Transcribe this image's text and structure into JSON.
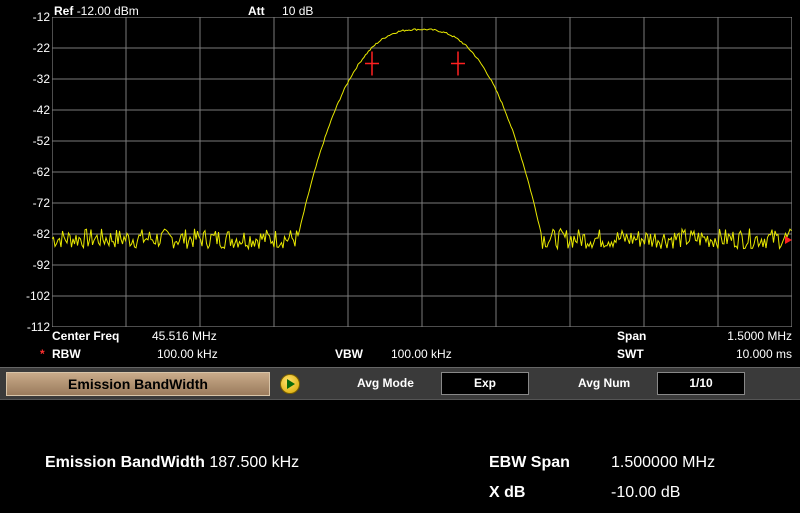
{
  "header": {
    "ref_label": "Ref",
    "ref_value": "-12.00 dBm",
    "att_label": "Att",
    "att_value": "10 dB"
  },
  "y_axis_ticks": [
    "-12",
    "-22",
    "-32",
    "-42",
    "-52",
    "-62",
    "-72",
    "-82",
    "-92",
    "-102",
    "-112"
  ],
  "status": {
    "center_label": "Center Freq",
    "center_value": "45.516 MHz",
    "span_label": "Span",
    "span_value": "1.5000 MHz",
    "rbw_star": "*",
    "rbw_label": "RBW",
    "rbw_value": "100.00 kHz",
    "vbw_label": "VBW",
    "vbw_value": "100.00 kHz",
    "swt_label": "SWT",
    "swt_value": "10.000 ms"
  },
  "toolbar": {
    "title": "Emission BandWidth",
    "avg_mode_label": "Avg Mode",
    "avg_mode_value": "Exp",
    "avg_num_label": "Avg Num",
    "avg_num_value": "1/10"
  },
  "results": {
    "ebw_label": "Emission BandWidth",
    "ebw_value": "187.500 kHz",
    "span_label": "EBW Span",
    "span_value": "1.500000 MHz",
    "xdb_label": "X dB",
    "xdb_value": "-10.00 dB"
  },
  "colors": {
    "trace": "#e8e800",
    "grid": "#7a7a7a",
    "marker": "#ff2020"
  }
}
